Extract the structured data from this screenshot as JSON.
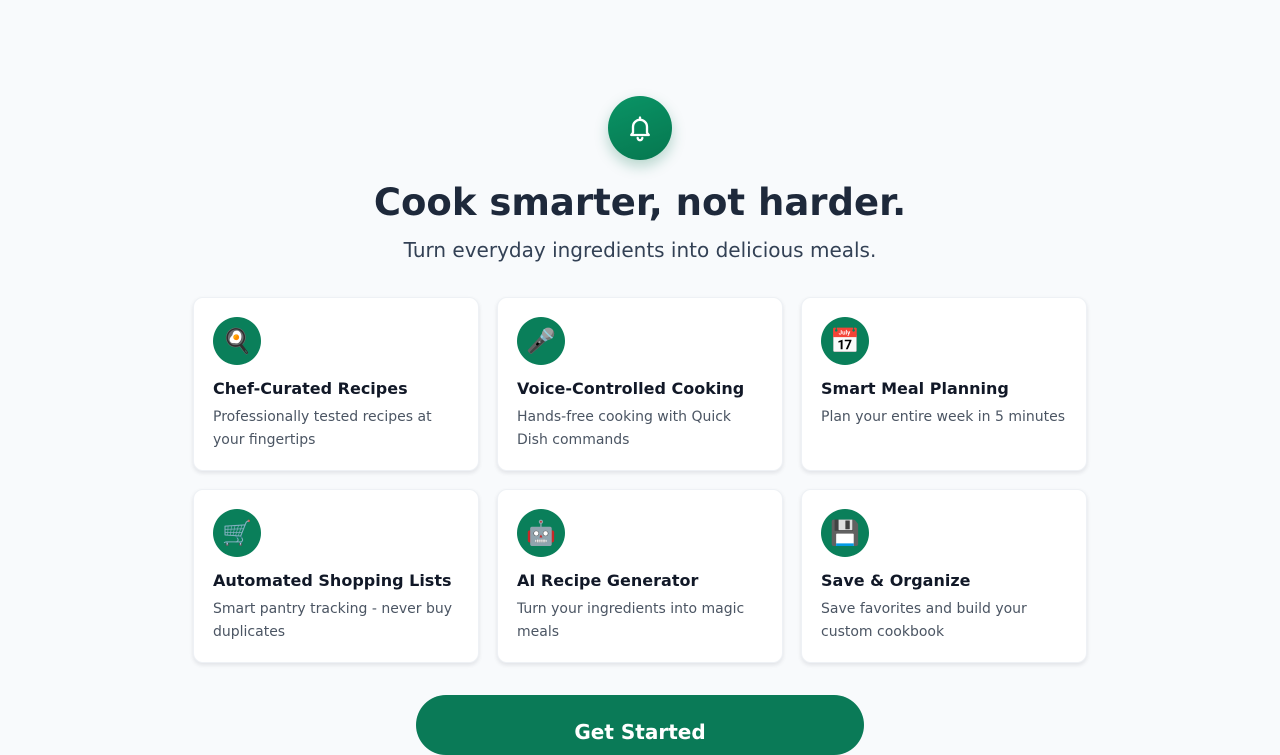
{
  "hero": {
    "icon": "bell-icon",
    "title": "Cook smarter, not harder.",
    "subtitle": "Turn everyday ingredients into delicious meals."
  },
  "features": [
    {
      "icon": "frying-pan-icon",
      "glyph": "🍳",
      "title": "Chef-Curated Recipes",
      "description": "Professionally tested recipes at your fingertips"
    },
    {
      "icon": "microphone-icon",
      "glyph": "🎤",
      "title": "Voice-Controlled Cooking",
      "description": "Hands-free cooking with Quick Dish commands"
    },
    {
      "icon": "calendar-icon",
      "glyph": "📅",
      "title": "Smart Meal Planning",
      "description": "Plan your entire week in 5 minutes"
    },
    {
      "icon": "shopping-cart-icon",
      "glyph": "🛒",
      "title": "Automated Shopping Lists",
      "description": "Smart pantry tracking - never buy duplicates"
    },
    {
      "icon": "robot-icon",
      "glyph": "🤖",
      "title": "AI Recipe Generator",
      "description": "Turn your ingredients into magic meals"
    },
    {
      "icon": "floppy-disk-icon",
      "glyph": "💾",
      "title": "Save & Organize",
      "description": "Save favorites and build your custom cookbook"
    }
  ],
  "cta": {
    "label": "Get Started"
  },
  "colors": {
    "accent": "#0a7f5a",
    "background": "#f8fafc",
    "headline": "#1e293b"
  }
}
